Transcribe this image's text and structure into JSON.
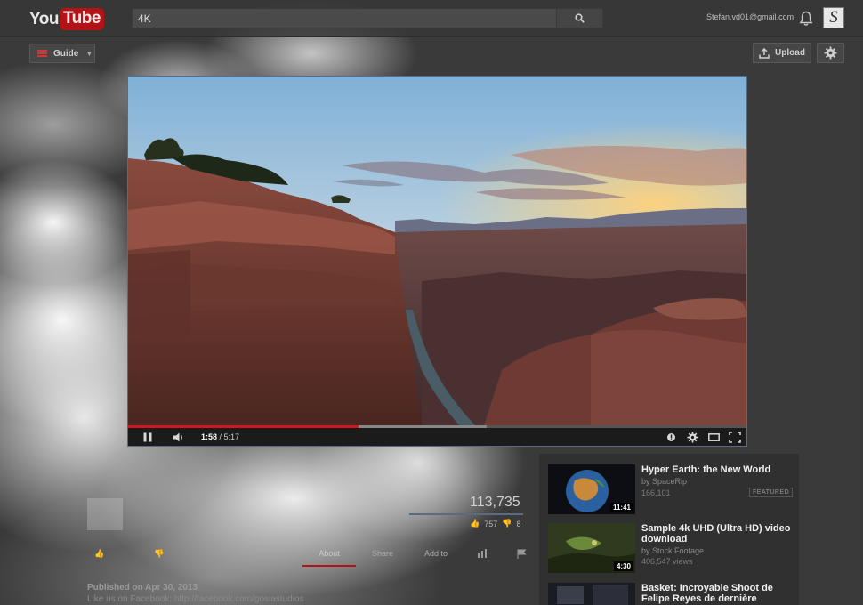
{
  "masthead": {
    "logo_you": "You",
    "logo_tube": "Tube",
    "search_value": "4K",
    "account_email": "Stefan.vd01@gmail.com",
    "avatar_letter": "S"
  },
  "toolbar": {
    "guide_label": "Guide",
    "upload_label": "Upload"
  },
  "player": {
    "current_time": "1:58",
    "separator": " / ",
    "duration": "5:17",
    "played_fraction": 0.372,
    "loaded_fraction": 0.58
  },
  "video_info": {
    "view_count": "113,735",
    "likes": "757",
    "dislikes": "8",
    "tabs": [
      "About",
      "Share",
      "Add to"
    ],
    "published": "Published on Apr 30, 2013",
    "description_line": "Like us on Facebook: http://facebook.com/gosiastudios"
  },
  "sidebar": {
    "items": [
      {
        "title": "Hyper Earth: the New World",
        "by": "by SpaceRip",
        "meta": "166,101",
        "badge": "FEATURED",
        "duration": "11:41"
      },
      {
        "title": "Sample 4k UHD (Ultra HD) video download",
        "by": "by Stock Footage",
        "meta": "406,547 views",
        "duration": "4:30"
      },
      {
        "title": "Basket: Incroyable Shoot de Felipe Reyes de dernière"
      }
    ]
  },
  "colors": {
    "brand_red": "#b31217",
    "progress_red": "#cc181e",
    "accent_blue": "#5b6b82"
  }
}
